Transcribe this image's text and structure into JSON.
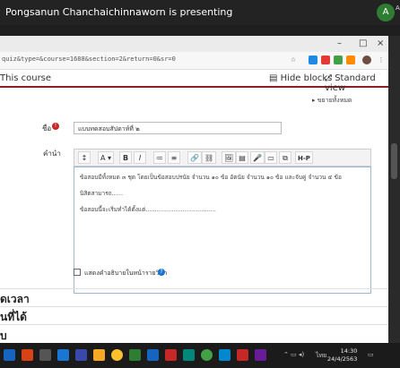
{
  "presenter": {
    "banner": "Pongsanun Chanchaichinnaworn is presenting",
    "avatar_letter": "A",
    "side_label": "A"
  },
  "browser": {
    "url": "quiz&type=&course=1688&section=2&return=0&sr=0",
    "window_controls": {
      "minimize": "–",
      "maximize": "□",
      "close": "×"
    }
  },
  "coursebar": {
    "course_link": "This course",
    "hide_blocks": "Hide blocks",
    "standard_view": "Standard view"
  },
  "form": {
    "expand_all": "ขยายทั้งหมด",
    "name_label": "ชื่อ",
    "name_value": "แบบทดสอบสัปดาห์ที่ ๒",
    "desc_label": "คำนำ",
    "toolbar": [
      "↕",
      "A ▾",
      "B",
      "I",
      "≔",
      "≡",
      "🔗",
      "⛓",
      "🖼",
      "▤",
      "🎤",
      "▭",
      "⧉",
      "H-P"
    ],
    "editor_lines": [
      "ข้อสอบมีทั้งหมด ๓ ชุด โดยเป็นข้อสอบปรนัย จำนวน ๑๐ ข้อ อัตนัย จำนวน ๑๐ ข้อ และจับคู่ จำนวน ๕ ข้อ",
      "นิสิตสามารถ......",
      "ข้อสอบนี้จะเริ่มทำได้ตั้งแต่......................................"
    ],
    "show_description": "แสดงคำอธิบายในหน้ารายวิชา",
    "help_icon": "?"
  },
  "sections": [
    "ดเวลา",
    "นที่ได้",
    "บ"
  ],
  "taskbar": {
    "time": "14:30",
    "date": "24/4/2563",
    "lang": "ไทย"
  }
}
